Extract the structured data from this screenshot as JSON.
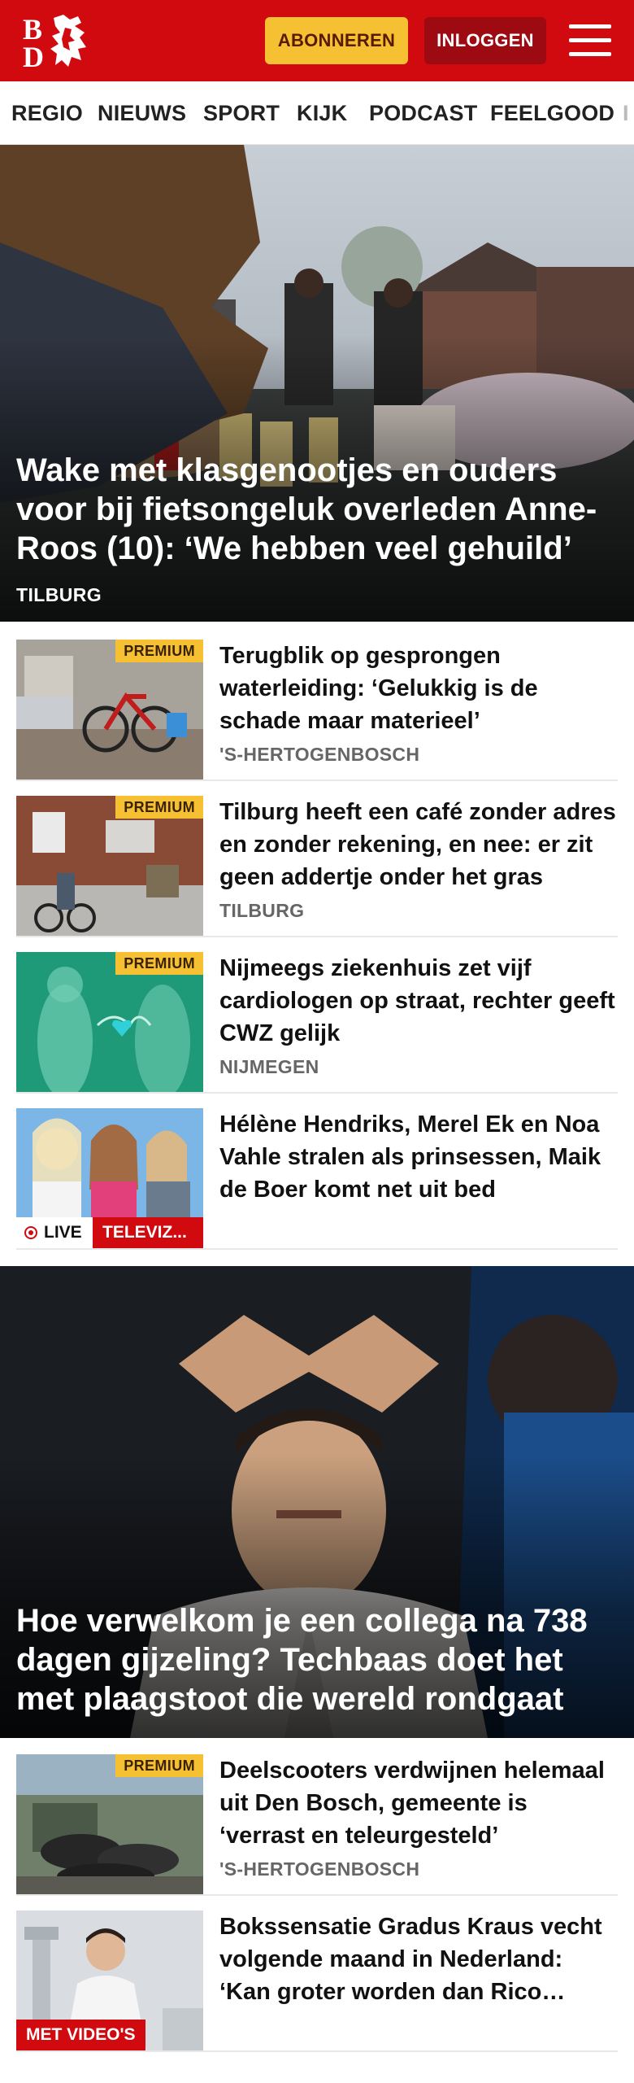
{
  "header": {
    "logo_text": "BD",
    "subscribe_label": "ABONNEREN",
    "login_label": "INLOGGEN",
    "menu_icon": "hamburger-menu-icon",
    "brand_color": "#d10a10",
    "subscribe_color": "#f6c033"
  },
  "nav": {
    "items": [
      "REGIO",
      "NIEUWS",
      "SPORT",
      "KIJK",
      "PODCAST",
      "FEELGOOD",
      "I"
    ]
  },
  "hero1": {
    "title": "Wake met klasgenootjes en ouders voor bij fietsongeluk overleden Anne-Roos (10): ‘We hebben veel gehuild’",
    "tag": "TILBURG"
  },
  "articles": [
    {
      "title": "Terugblik op gesprongen waterleiding: ‘Gelukkig is de schade maar materieel’",
      "location": "'S-HERTOGENBOSCH",
      "badge": "PREMIUM"
    },
    {
      "title": "Tilburg heeft een café zonder adres en zonder rekening, en nee: er zit geen addertje onder het gras",
      "location": "TILBURG",
      "badge": "PREMIUM"
    },
    {
      "title": "Nijmeegs ziekenhuis zet vijf cardiologen op straat, rechter geeft CWZ gelijk",
      "location": "NIJMEGEN",
      "badge": "PREMIUM"
    },
    {
      "title": "Hélène Hendriks, Merel Ek en Noa Vahle stralen als prinsessen, Maik de Boer komt net uit bed",
      "live_label": "LIVE",
      "category": "TELEVIZ..."
    }
  ],
  "hero2": {
    "title": "Hoe verwelkom je een collega na 738 dagen gijzeling? Techbaas doet het met plaagstoot die wereld rondgaat"
  },
  "articles2": [
    {
      "title": "Deelscooters verdwijnen helemaal uit Den Bosch, gemeente is ‘verrast en teleurgesteld’",
      "location": "'S-HERTOGENBOSCH",
      "badge": "PREMIUM"
    },
    {
      "title": "Bokssensatie Gradus Kraus vecht volgende maand in Nederland: ‘Kan groter worden dan Rico Verhoeven’",
      "badge": "MET VIDEO'S"
    }
  ]
}
